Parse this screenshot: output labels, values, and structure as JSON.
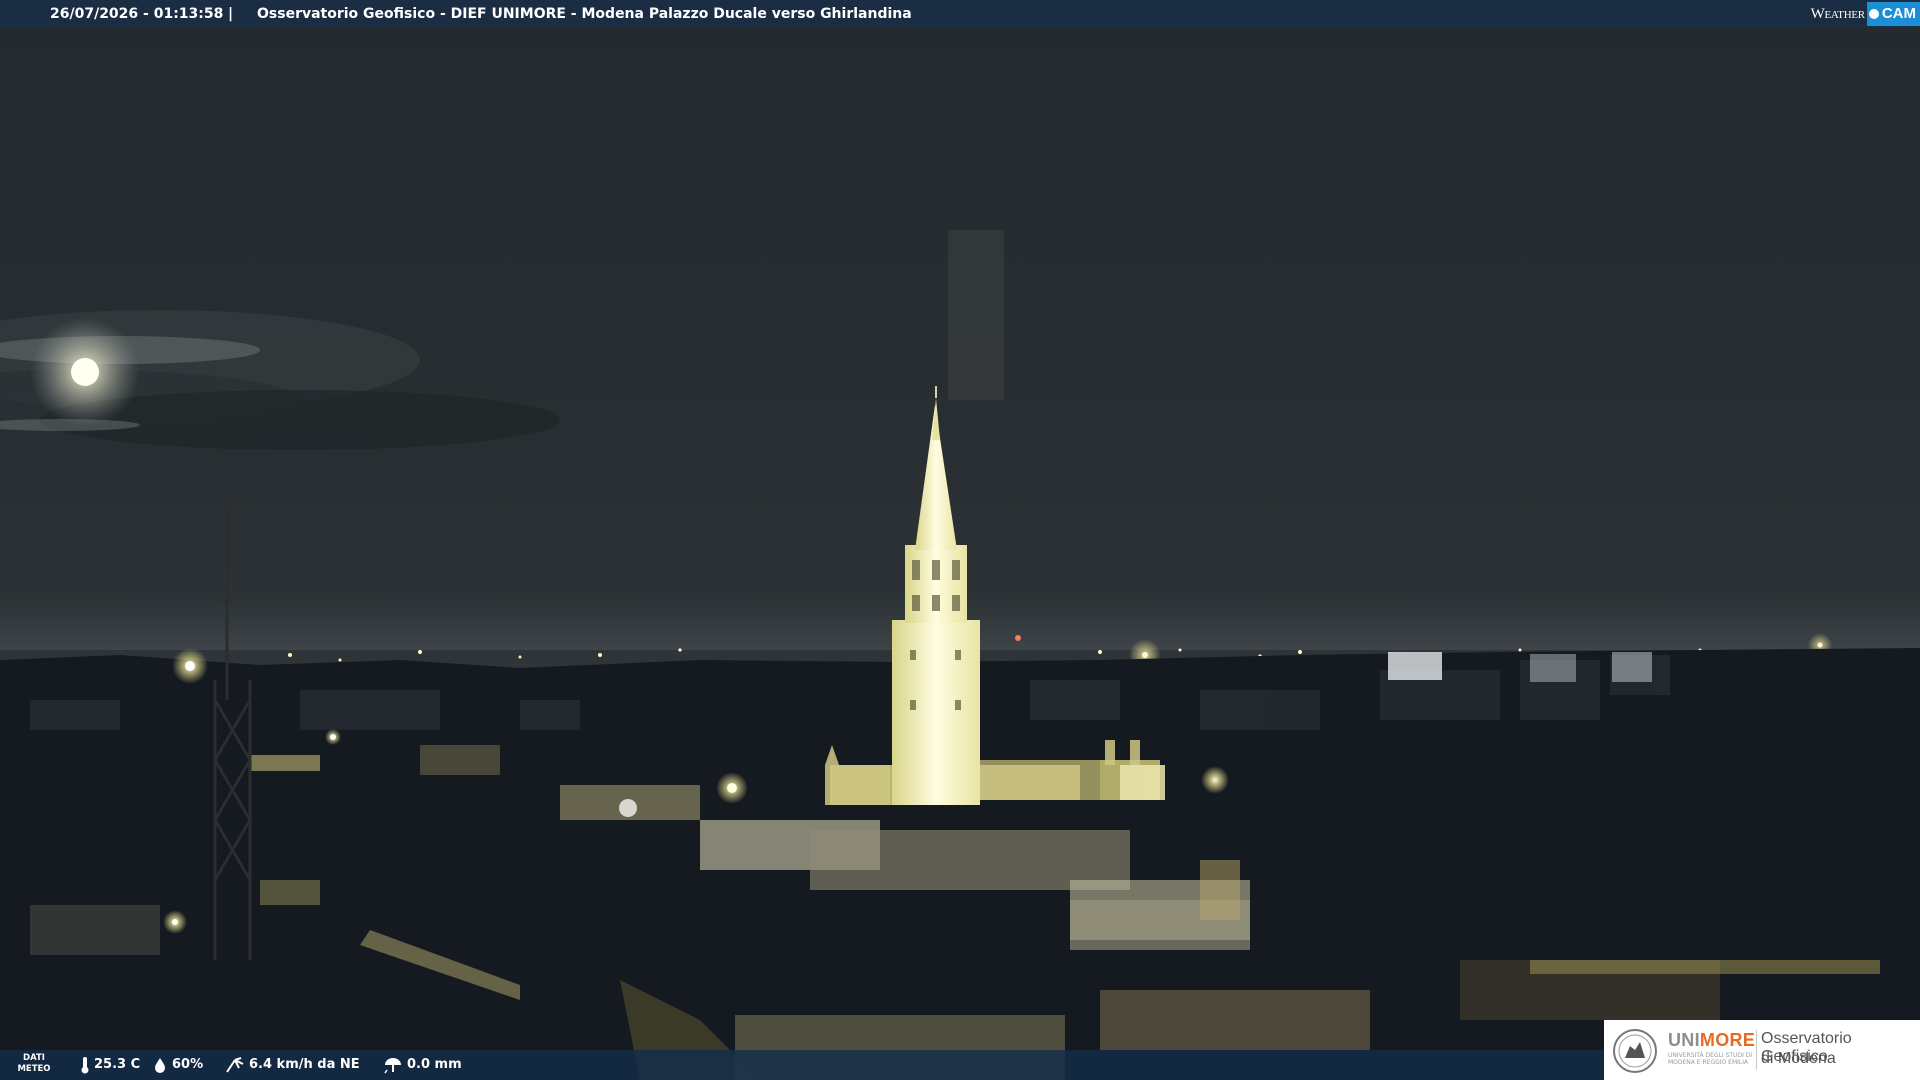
{
  "header": {
    "timestamp": "26/07/2026 - 01:13:58",
    "separator": "|",
    "camera_title": "Osservatorio Geofisico - DIEF UNIMORE - Modena Palazzo Ducale verso Ghirlandina",
    "logo_left": "Weather",
    "logo_right": "CAM"
  },
  "meteo": {
    "badge_line1": "DATI",
    "badge_line2": "METEO",
    "temperature": "25.3 C",
    "humidity": "60%",
    "wind": "6.4 km/h da NE",
    "rain": "0.0 mm",
    "icons": [
      "thermometer-icon",
      "humidity-drop-icon",
      "wind-icon",
      "rain-icon"
    ]
  },
  "brand": {
    "uni": "UNI",
    "more": "MORE",
    "subtitle": "UNIVERSITÀ DEGLI STUDI DI MODENA E REGGIO EMILIA",
    "observatory_line1": "Osservatorio Geofisico",
    "observatory_line2": "di Modena",
    "colors": {
      "more": "#e36b24",
      "uni": "#8a8f93",
      "weathercam_blue": "#1a8fd6"
    }
  }
}
